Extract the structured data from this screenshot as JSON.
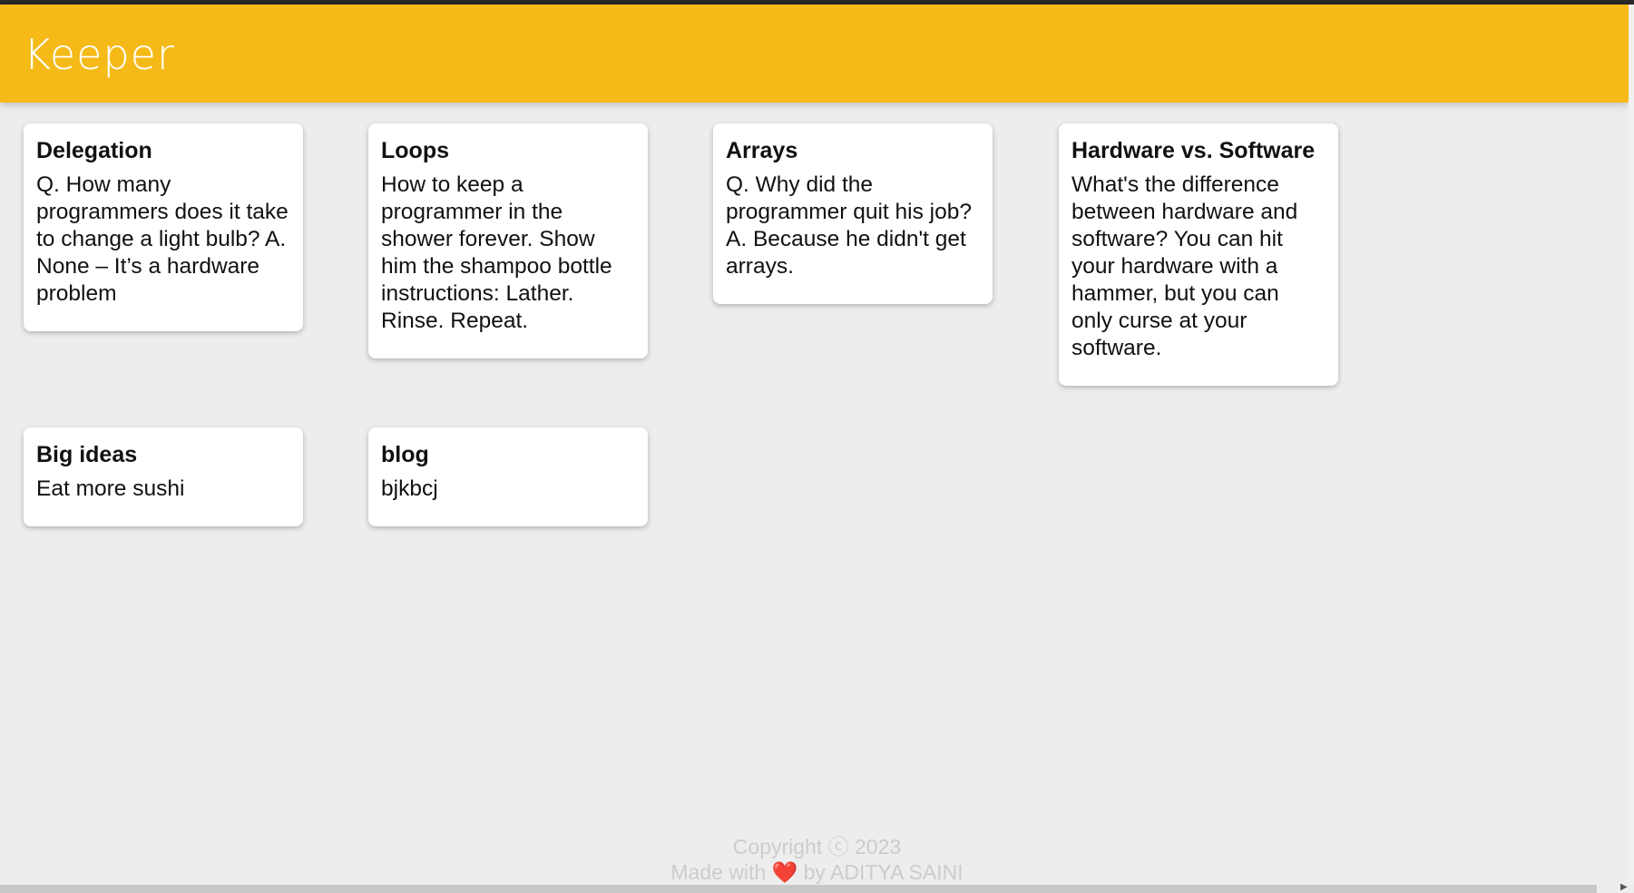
{
  "header": {
    "title": "Keeper"
  },
  "notes": [
    {
      "title": "Delegation",
      "content": "Q. How many programmers does it take to change a light bulb? A. None – It’s a hardware problem"
    },
    {
      "title": "Loops",
      "content": "How to keep a programmer in the shower forever. Show him the shampoo bottle instructions: Lather. Rinse. Repeat."
    },
    {
      "title": "Arrays",
      "content": "Q. Why did the programmer quit his job? A. Because he didn't get arrays."
    },
    {
      "title": "Hardware vs. Software",
      "content": "What's the difference between hardware and software? You can hit your hardware with a hammer, but you can only curse at your software."
    },
    {
      "title": "Big ideas",
      "content": "Eat more sushi"
    },
    {
      "title": "blog",
      "content": "bjkbcj"
    }
  ],
  "footer": {
    "copyright": "Copyright ⓒ 2023",
    "made_with": "Made with ❤️ by ADITYA SAINI"
  },
  "colors": {
    "header_bg": "#f5ba18",
    "page_bg": "#ededed",
    "card_bg": "#ffffff",
    "footer_text": "#cccccc"
  }
}
